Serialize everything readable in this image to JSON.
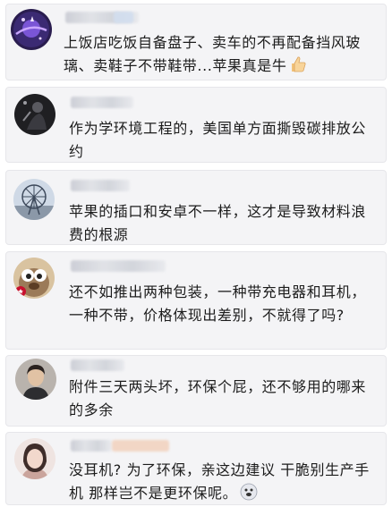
{
  "comments": [
    {
      "text": "上饭店吃饭自备盘子、卖车的不再配备挡风玻璃、卖鞋子不带鞋带...苹果真是牛",
      "emoji": "thumbs-up-icon",
      "avatar": "purple-planet-avatar"
    },
    {
      "text": "作为学环境工程的，美国单方面撕毁碳排放公约",
      "avatar": "dark-figure-avatar"
    },
    {
      "text": "苹果的插口和安卓不一样，这才是导致材料浪费的根源",
      "avatar": "ferris-wheel-avatar"
    },
    {
      "text": "还不如推出两种包装，一种带充电器和耳机，一种不带，价格体现出差别，不就得了吗?",
      "avatar": "cartoon-squirrel-avatar"
    },
    {
      "text": "附件三天两头坏，环保个屁，还不够用的哪来的多余",
      "avatar": "man-portrait-avatar"
    },
    {
      "text": "没耳机? 为了环保，亲这边建议 干脆别生产手机 那样岂不是更环保呢。",
      "emoji": "doge-icon",
      "avatar": "woman-portrait-avatar"
    }
  ],
  "colors": {
    "card_bg": "#f4f4f6",
    "text": "#1c1c1c"
  }
}
